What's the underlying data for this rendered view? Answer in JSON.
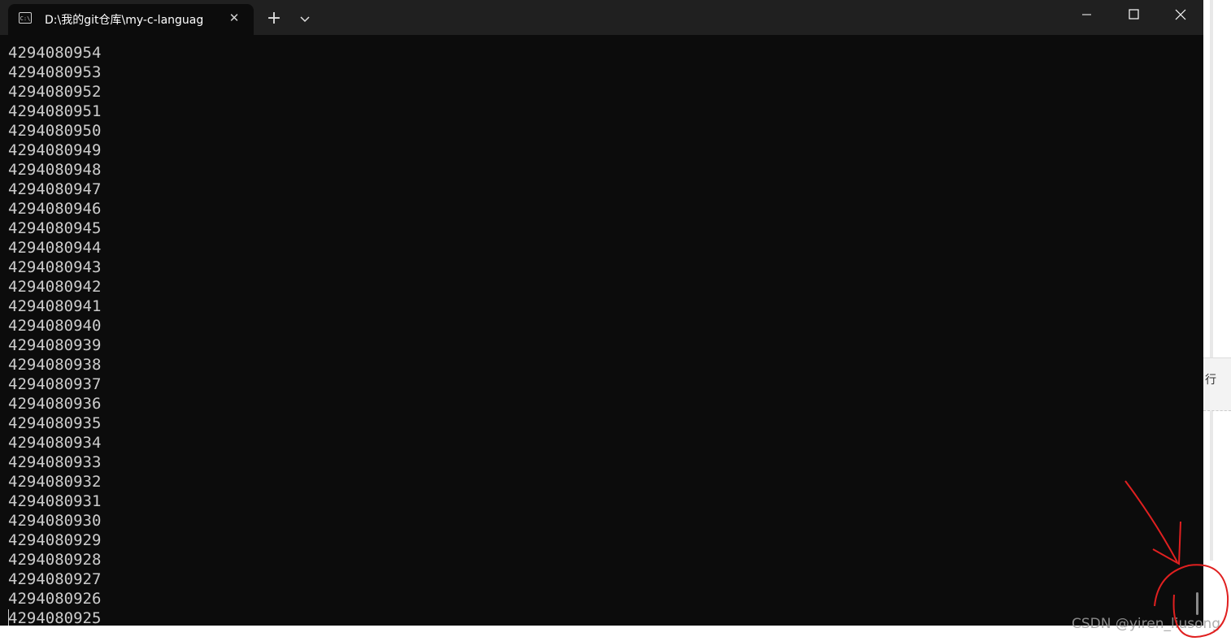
{
  "window": {
    "tab_title": "D:\\我的git仓库\\my-c-languag",
    "tab_icon_text": "C:\\",
    "new_tab_symbol": "+",
    "close_tab_symbol": "✕"
  },
  "console": {
    "lines": [
      "4294080954",
      "4294080953",
      "4294080952",
      "4294080951",
      "4294080950",
      "4294080949",
      "4294080948",
      "4294080947",
      "4294080946",
      "4294080945",
      "4294080944",
      "4294080943",
      "4294080942",
      "4294080941",
      "4294080940",
      "4294080939",
      "4294080938",
      "4294080937",
      "4294080936",
      "4294080935",
      "4294080934",
      "4294080933",
      "4294080932",
      "4294080931",
      "4294080930",
      "4294080929",
      "4294080928",
      "4294080927",
      "4294080926",
      "4294080925"
    ]
  },
  "background": {
    "side_char": "行"
  },
  "watermark": "CSDN @yiren_liusong",
  "colors": {
    "terminal_bg": "#0c0c0c",
    "titlebar_bg": "#202020",
    "text": "#cccccc",
    "annotation": "#e02020"
  }
}
